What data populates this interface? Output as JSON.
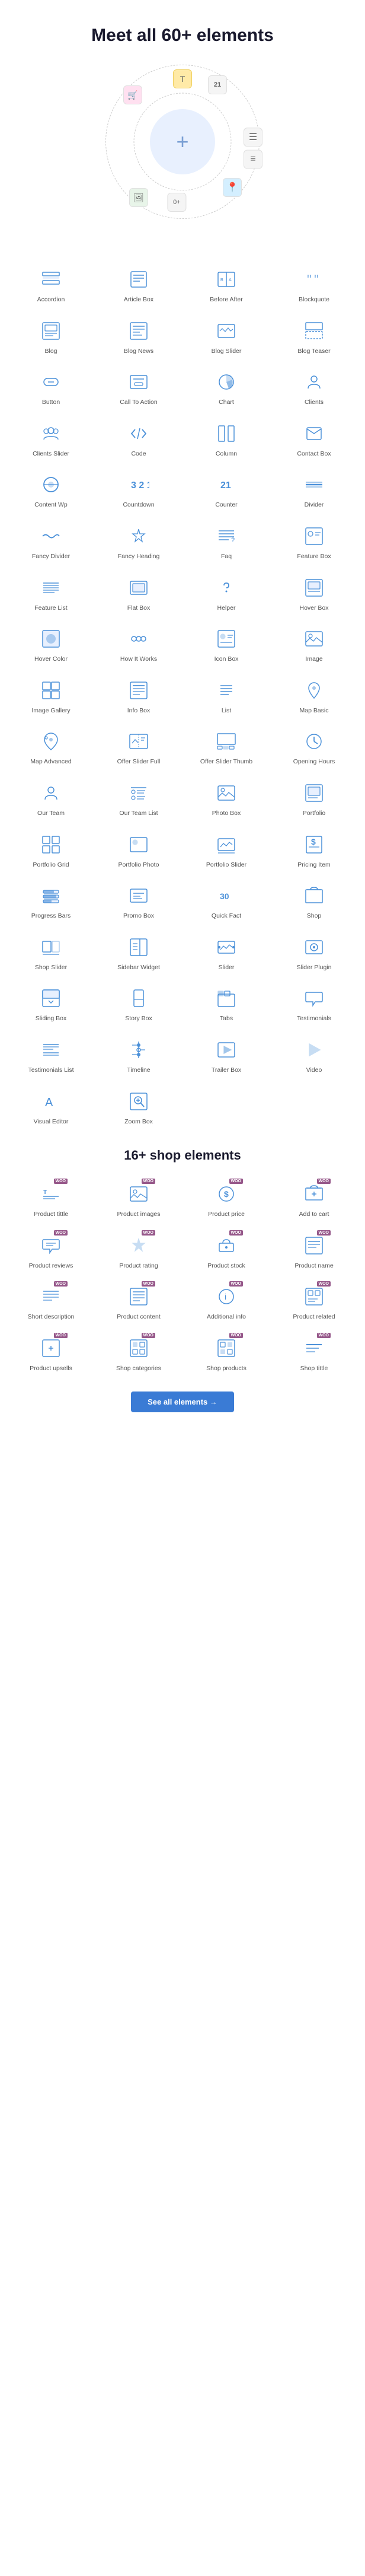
{
  "hero": {
    "title": "Meet all 60+ elements"
  },
  "circle_items": [
    {
      "icon": "T",
      "label": "",
      "pos": "top"
    },
    {
      "icon": "21",
      "label": "",
      "pos": "topright"
    },
    {
      "icon": "≡",
      "label": "",
      "pos": "right"
    },
    {
      "icon": "≡",
      "label": "",
      "pos": "right2"
    },
    {
      "icon": "0+",
      "label": "",
      "pos": "bottom"
    },
    {
      "icon": "📍",
      "label": "",
      "pos": "bottomright"
    },
    {
      "icon": "🖼",
      "label": "",
      "pos": "bottomleft"
    },
    {
      "icon": "🛒",
      "label": "",
      "pos": "topleft"
    }
  ],
  "elements": [
    {
      "id": "accordion",
      "label": "Accordion"
    },
    {
      "id": "article-box",
      "label": "Article Box"
    },
    {
      "id": "before-after",
      "label": "Before After"
    },
    {
      "id": "blockquote",
      "label": "Blockquote"
    },
    {
      "id": "blog",
      "label": "Blog"
    },
    {
      "id": "blog-news",
      "label": "Blog News"
    },
    {
      "id": "blog-slider",
      "label": "Blog Slider"
    },
    {
      "id": "blog-teaser",
      "label": "Blog Teaser"
    },
    {
      "id": "button",
      "label": "Button"
    },
    {
      "id": "call-to-action",
      "label": "Call To Action"
    },
    {
      "id": "chart",
      "label": "Chart"
    },
    {
      "id": "clients",
      "label": "Clients"
    },
    {
      "id": "clients-slider",
      "label": "Clients Slider"
    },
    {
      "id": "code",
      "label": "Code"
    },
    {
      "id": "column",
      "label": "Column"
    },
    {
      "id": "contact-box",
      "label": "Contact Box"
    },
    {
      "id": "content-wp",
      "label": "Content Wp"
    },
    {
      "id": "countdown",
      "label": "Countdown"
    },
    {
      "id": "counter",
      "label": "Counter"
    },
    {
      "id": "divider",
      "label": "Divider"
    },
    {
      "id": "fancy-divider",
      "label": "Fancy Divider"
    },
    {
      "id": "fancy-heading",
      "label": "Fancy Heading"
    },
    {
      "id": "faq",
      "label": "Faq"
    },
    {
      "id": "feature-box",
      "label": "Feature Box"
    },
    {
      "id": "feature-list",
      "label": "Feature List"
    },
    {
      "id": "flat-box",
      "label": "Flat Box"
    },
    {
      "id": "helper",
      "label": "Helper"
    },
    {
      "id": "hover-box",
      "label": "Hover Box"
    },
    {
      "id": "hover-color",
      "label": "Hover Color"
    },
    {
      "id": "how-it-works",
      "label": "How It Works"
    },
    {
      "id": "icon-box",
      "label": "Icon Box"
    },
    {
      "id": "image",
      "label": "Image"
    },
    {
      "id": "image-gallery",
      "label": "Image Gallery"
    },
    {
      "id": "info-box",
      "label": "Info Box"
    },
    {
      "id": "list",
      "label": "List"
    },
    {
      "id": "map-basic",
      "label": "Map Basic"
    },
    {
      "id": "map-advanced",
      "label": "Map Advanced"
    },
    {
      "id": "offer-slider-full",
      "label": "Offer Slider Full"
    },
    {
      "id": "offer-slider-thumb",
      "label": "Offer Slider Thumb"
    },
    {
      "id": "opening-hours",
      "label": "Opening Hours"
    },
    {
      "id": "our-team",
      "label": "Our Team"
    },
    {
      "id": "our-team-list",
      "label": "Our Team List"
    },
    {
      "id": "photo-box",
      "label": "Photo Box"
    },
    {
      "id": "portfolio",
      "label": "Portfolio"
    },
    {
      "id": "portfolio-grid",
      "label": "Portfolio Grid"
    },
    {
      "id": "portfolio-photo",
      "label": "Portfolio Photo"
    },
    {
      "id": "portfolio-slider",
      "label": "Portfolio Slider"
    },
    {
      "id": "pricing-item",
      "label": "Pricing Item"
    },
    {
      "id": "progress-bars",
      "label": "Progress Bars"
    },
    {
      "id": "promo-box",
      "label": "Promo Box"
    },
    {
      "id": "quick-fact",
      "label": "Quick Fact"
    },
    {
      "id": "shop",
      "label": "Shop"
    },
    {
      "id": "shop-slider",
      "label": "Shop Slider"
    },
    {
      "id": "sidebar-widget",
      "label": "Sidebar Widget"
    },
    {
      "id": "slider",
      "label": "Slider"
    },
    {
      "id": "slider-plugin",
      "label": "Slider Plugin"
    },
    {
      "id": "sliding-box",
      "label": "Sliding Box"
    },
    {
      "id": "story-box",
      "label": "Story Box"
    },
    {
      "id": "tabs",
      "label": "Tabs"
    },
    {
      "id": "testimonials",
      "label": "Testimonials"
    },
    {
      "id": "testimonials-list",
      "label": "Testimonials List"
    },
    {
      "id": "timeline",
      "label": "Timeline"
    },
    {
      "id": "trailer-box",
      "label": "Trailer Box"
    },
    {
      "id": "video",
      "label": "Video"
    },
    {
      "id": "visual-editor",
      "label": "Visual Editor"
    },
    {
      "id": "zoom-box",
      "label": "Zoom Box"
    }
  ],
  "shop_section": {
    "title": "16+ shop elements"
  },
  "shop_elements": [
    {
      "id": "product-title",
      "label": "Product tittle",
      "woo": true
    },
    {
      "id": "product-images",
      "label": "Product images",
      "woo": true
    },
    {
      "id": "product-price",
      "label": "Product price",
      "woo": true
    },
    {
      "id": "add-to-cart",
      "label": "Add to cart",
      "woo": true
    },
    {
      "id": "product-reviews",
      "label": "Product reviews",
      "woo": true
    },
    {
      "id": "product-rating",
      "label": "Product rating",
      "woo": true
    },
    {
      "id": "product-stock",
      "label": "Product stock",
      "woo": true
    },
    {
      "id": "product-name",
      "label": "Product name",
      "woo": true
    },
    {
      "id": "short-description",
      "label": "Short description",
      "woo": true
    },
    {
      "id": "product-content",
      "label": "Product content",
      "woo": true
    },
    {
      "id": "additional-info",
      "label": "Additional info",
      "woo": true
    },
    {
      "id": "product-related",
      "label": "Product related",
      "woo": true
    },
    {
      "id": "product-upsells",
      "label": "Product upsells",
      "woo": true
    },
    {
      "id": "shop-categories",
      "label": "Shop categories",
      "woo": true
    },
    {
      "id": "shop-products",
      "label": "Shop products",
      "woo": true
    },
    {
      "id": "shop-title",
      "label": "Shop tittle",
      "woo": true
    }
  ],
  "see_all_button": {
    "label": "See all elements →"
  }
}
